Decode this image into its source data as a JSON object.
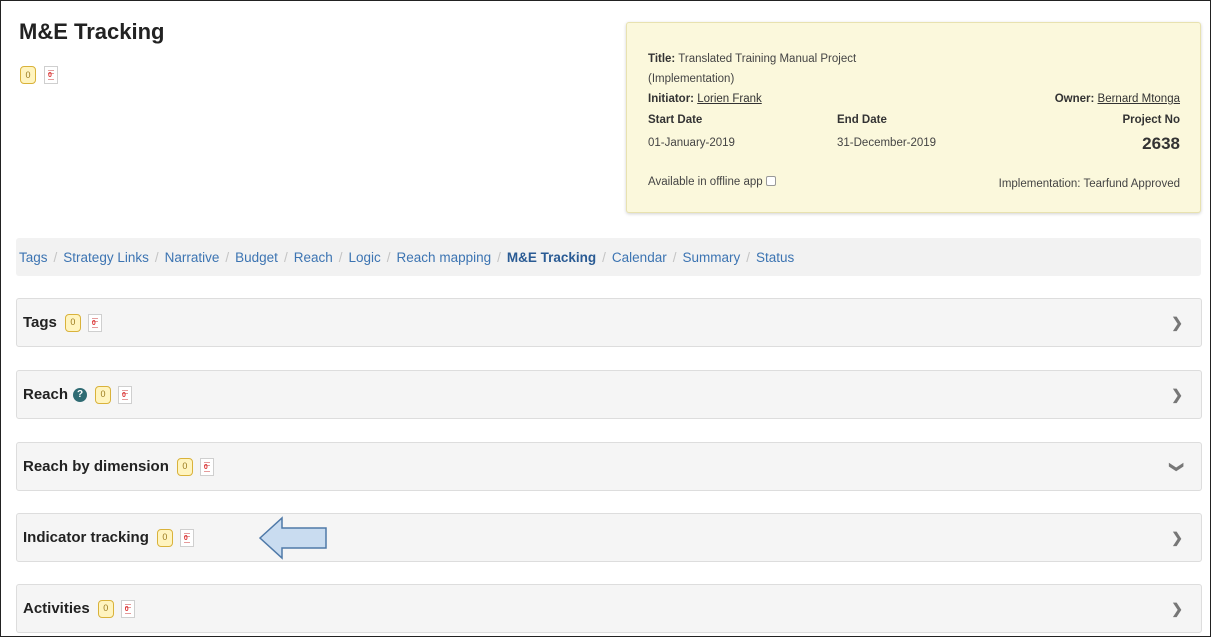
{
  "page": {
    "title": "M&E Tracking"
  },
  "badges": {
    "count": "0",
    "pdf": "0"
  },
  "project": {
    "title_label": "Title:",
    "title_value": "Translated Training Manual Project",
    "title_value_2": "(Implementation)",
    "initiator_label": "Initiator:",
    "initiator_value": "Lorien Frank",
    "owner_label": "Owner:",
    "owner_value": "Bernard Mtonga",
    "start_label": "Start Date",
    "start_value": "01-January-2019",
    "end_label": "End Date",
    "end_value": "31-December-2019",
    "project_no_label": "Project No",
    "project_no_value": "2638",
    "offline_label": "Available in offline app",
    "status_text": "Implementation: Tearfund Approved"
  },
  "breadcrumbs": [
    {
      "label": "Tags"
    },
    {
      "label": "Strategy Links"
    },
    {
      "label": "Narrative"
    },
    {
      "label": "Budget"
    },
    {
      "label": "Reach"
    },
    {
      "label": "Logic"
    },
    {
      "label": "Reach mapping"
    },
    {
      "label": "M&E Tracking",
      "active": true
    },
    {
      "label": "Calendar"
    },
    {
      "label": "Summary"
    },
    {
      "label": "Status"
    }
  ],
  "panels": [
    {
      "title": "Tags",
      "chevron": "right"
    },
    {
      "title": "Reach",
      "chevron": "right",
      "help_icon": "question-circle-icon"
    },
    {
      "title": "Reach by dimension",
      "chevron": "down"
    },
    {
      "title": "Indicator tracking",
      "chevron": "right"
    },
    {
      "title": "Activities",
      "chevron": "right"
    }
  ],
  "colors": {
    "link": "#3c74b2",
    "info_box_bg": "#fbf8dc",
    "badge_yellow": "#fff4bf",
    "arrow_fill": "#c9dcf0"
  }
}
